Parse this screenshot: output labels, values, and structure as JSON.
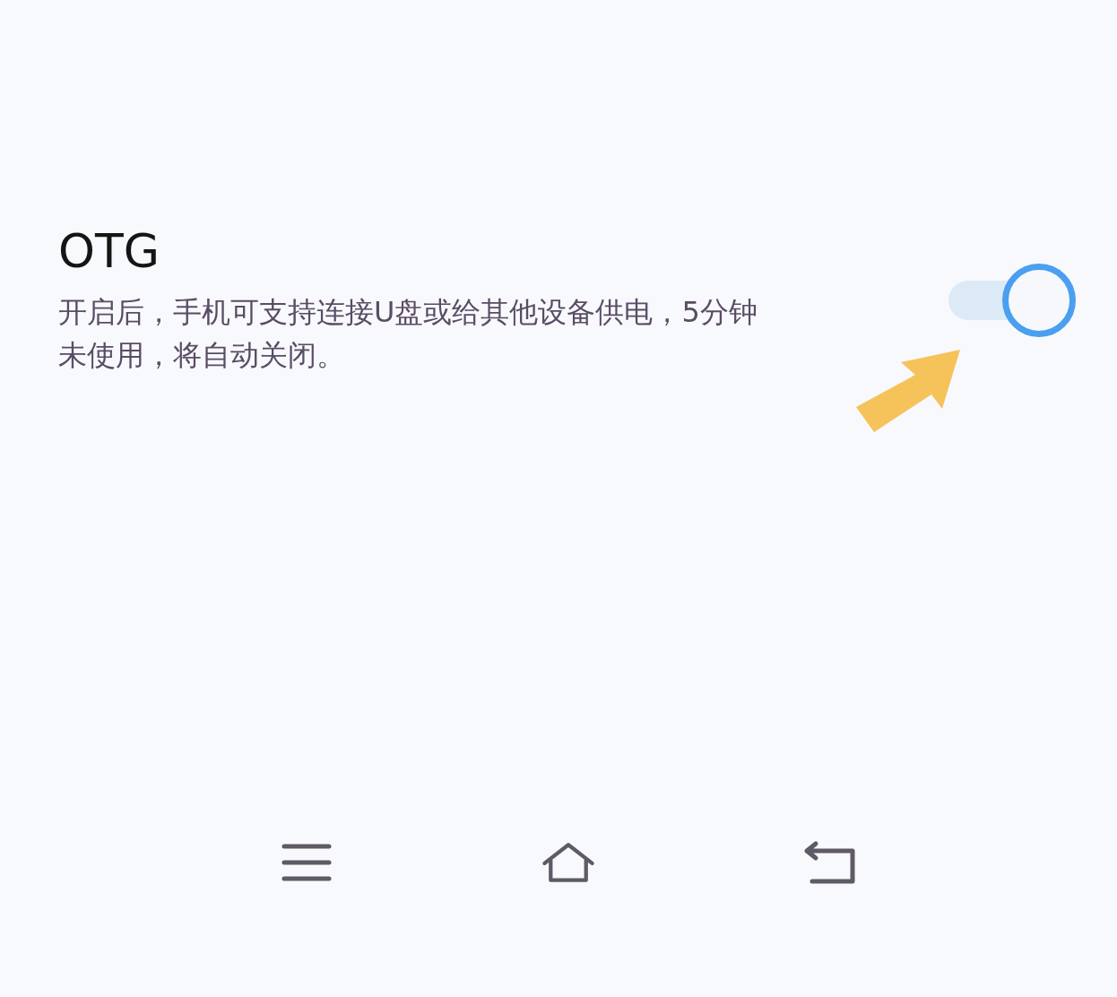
{
  "setting": {
    "title": "OTG",
    "description": "开启后，手机可支持连接U盘或给其他设备供电，5分钟未使用，将自动关闭。",
    "on": true
  },
  "nav_bar": {
    "buttons": [
      {
        "kind": "menu"
      },
      {
        "kind": "home"
      },
      {
        "kind": "back"
      }
    ]
  }
}
